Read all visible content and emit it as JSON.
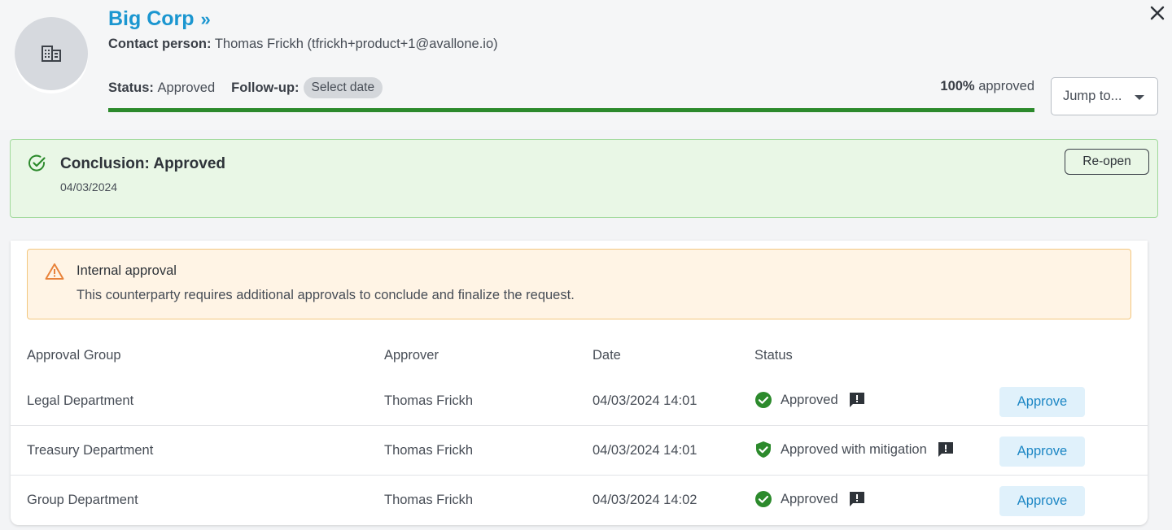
{
  "header": {
    "company": "Big Corp",
    "company_chevron": "»",
    "contact_label": "Contact person:",
    "contact_value": "Thomas Frickh (tfrickh+product+1@avallone.io)",
    "status_label": "Status:",
    "status_value": "Approved",
    "followup_label": "Follow-up:",
    "followup_placeholder": "Select date",
    "percent_value": "100%",
    "percent_suffix": "approved",
    "progress": 100,
    "jump_label": "Jump to...",
    "avatar_icon": "building-icon"
  },
  "conclusion": {
    "title": "Conclusion: Approved",
    "date": "04/03/2024",
    "reopen_label": "Re-open"
  },
  "internal_approval": {
    "title": "Internal approval",
    "message": "This counterparty requires additional approvals to conclude and finalize the request."
  },
  "table": {
    "columns": [
      "Approval Group",
      "Approver",
      "Date",
      "Status"
    ],
    "rows": [
      {
        "group": "Legal Department",
        "approver": "Thomas Frickh",
        "date": "04/03/2024 14:01",
        "status": "Approved",
        "status_icon": "check-circle-icon",
        "action": "Approve"
      },
      {
        "group": "Treasury Department",
        "approver": "Thomas Frickh",
        "date": "04/03/2024 14:01",
        "status": "Approved with mitigation",
        "status_icon": "shield-check-icon",
        "action": "Approve"
      },
      {
        "group": "Group Department",
        "approver": "Thomas Frickh",
        "date": "04/03/2024 14:02",
        "status": "Approved",
        "status_icon": "check-circle-icon",
        "action": "Approve"
      }
    ]
  },
  "colors": {
    "brand": "#1b96d0",
    "success": "#2c8a2c",
    "warning": "#e8823a"
  }
}
